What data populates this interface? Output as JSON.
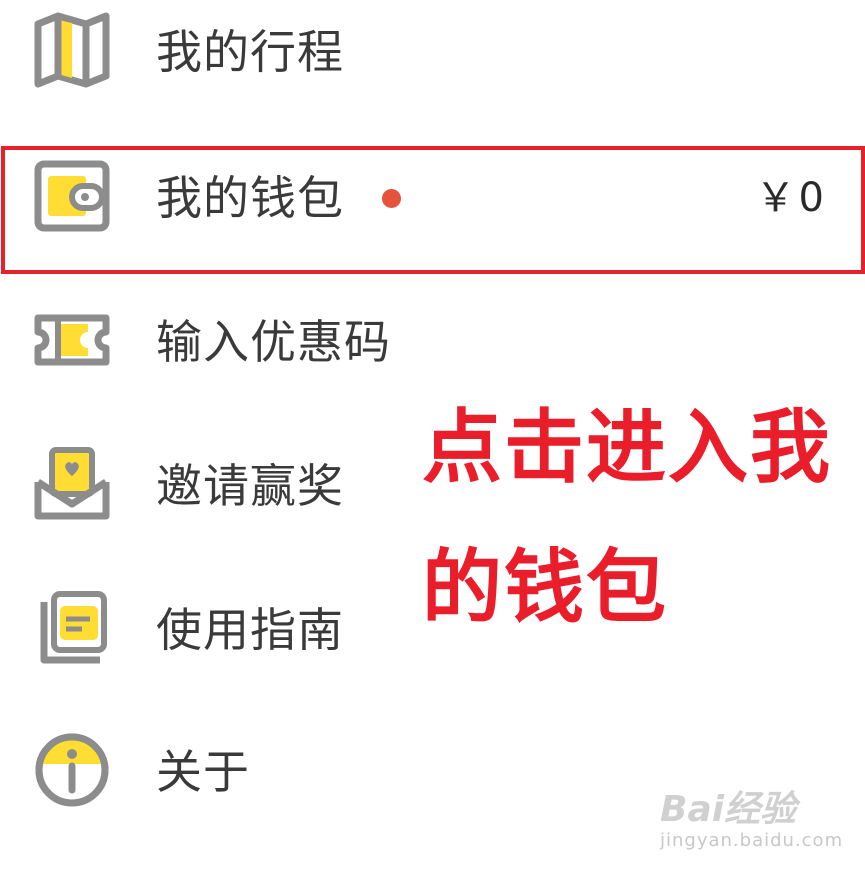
{
  "menu": {
    "items": [
      {
        "label": "我的行程",
        "icon": "map-icon"
      },
      {
        "label": "我的钱包",
        "icon": "wallet-icon",
        "balance": "￥0",
        "has_notice": true
      },
      {
        "label": "输入优惠码",
        "icon": "ticket-icon"
      },
      {
        "label": "邀请赢奖",
        "icon": "invite-envelope-icon"
      },
      {
        "label": "使用指南",
        "icon": "guide-icon"
      },
      {
        "label": "关于",
        "icon": "info-icon"
      }
    ]
  },
  "annotation": {
    "line1": "点击进入我",
    "line2": "的钱包",
    "color": "#ea1d2a"
  },
  "watermark": {
    "logo": "Bai经验",
    "site": "jingyan.baidu.com"
  },
  "colors": {
    "accent_yellow": "#ffdd33",
    "icon_gray": "#8c8c8c",
    "notice_dot": "#e5533d",
    "highlight_red": "#e8202a"
  }
}
